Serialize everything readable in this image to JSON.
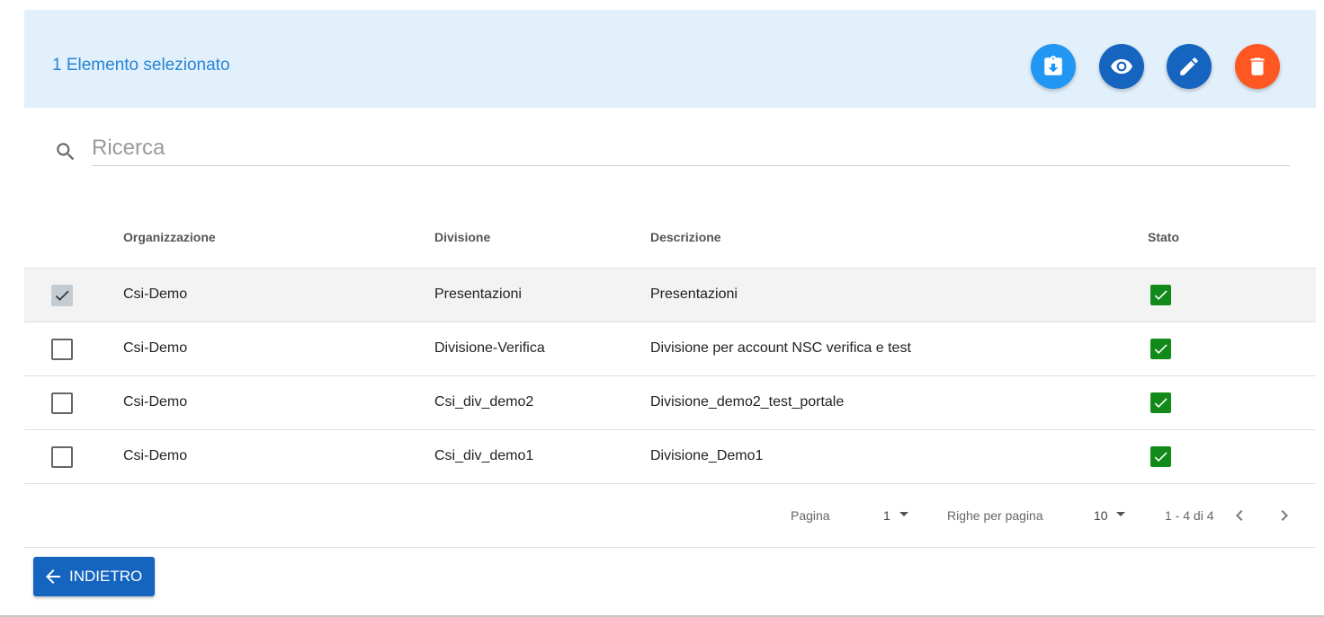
{
  "selection_bar": {
    "text": "1 Elemento selezionato",
    "actions": [
      {
        "name": "export",
        "icon": "clipboard-download-icon",
        "color": "#2196f3"
      },
      {
        "name": "view",
        "icon": "eye-icon",
        "color": "#1565c0"
      },
      {
        "name": "edit",
        "icon": "pencil-icon",
        "color": "#1565c0"
      },
      {
        "name": "delete",
        "icon": "trash-icon",
        "color": "#ff5722"
      }
    ]
  },
  "search": {
    "placeholder": "Ricerca",
    "value": "",
    "icon": "search-icon"
  },
  "table": {
    "columns": [
      "Organizzazione",
      "Divisione",
      "Descrizione",
      "Stato"
    ],
    "rows": [
      {
        "selected": true,
        "organizzazione": "Csi-Demo",
        "divisione": "Presentazioni",
        "descrizione": "Presentazioni",
        "stato": true
      },
      {
        "selected": false,
        "organizzazione": "Csi-Demo",
        "divisione": "Divisione-Verifica",
        "descrizione": "Divisione per account NSC verifica e test",
        "stato": true
      },
      {
        "selected": false,
        "organizzazione": "Csi-Demo",
        "divisione": "Csi_div_demo2",
        "descrizione": "Divisione_demo2_test_portale",
        "stato": true
      },
      {
        "selected": false,
        "organizzazione": "Csi-Demo",
        "divisione": "Csi_div_demo1",
        "descrizione": "Divisione_Demo1",
        "stato": true
      }
    ]
  },
  "pagination": {
    "page_label": "Pagina",
    "page_value": "1",
    "rows_label": "Righe per pagina",
    "rows_value": "10",
    "range": "1 - 4 di 4"
  },
  "back_button": {
    "label": "INDIETRO",
    "icon": "arrow-left-icon"
  },
  "colors": {
    "selection_bg": "#e2f0fc",
    "selection_text": "#2684d4",
    "primary": "#1565c0",
    "status_ok": "#118a1a"
  }
}
